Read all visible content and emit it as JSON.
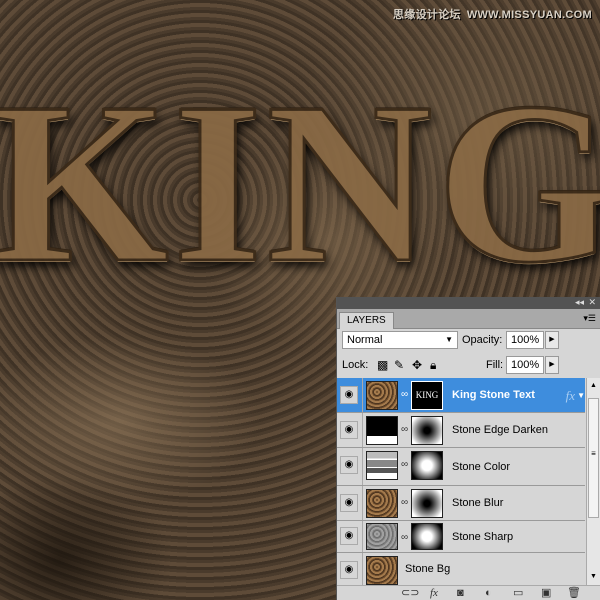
{
  "canvas": {
    "artwork_text": "KING"
  },
  "watermark": {
    "cn": "思缘设计论坛",
    "url": "WWW.MISSYUAN.COM"
  },
  "panel": {
    "collapse_icon": "double-chevron-left-icon",
    "close_icon": "close-icon",
    "tab": "LAYERS",
    "blend_mode": "Normal",
    "opacity_label": "Opacity:",
    "opacity": "100%",
    "lock_label": "Lock:",
    "fill_label": "Fill:",
    "fill": "100%",
    "layers": [
      {
        "name": "King Stone Text",
        "selected": true,
        "fx": "fx",
        "thumb": "stone",
        "mask": "KING"
      },
      {
        "name": "Stone Edge Darken",
        "thumb": "levels",
        "mask": "dark-center"
      },
      {
        "name": "Stone Color",
        "thumb": "hue-sat",
        "mask": "light-center"
      },
      {
        "name": "Stone Blur",
        "thumb": "stone",
        "mask": "dark-center"
      },
      {
        "name": "Stone Sharp",
        "thumb": "gray",
        "mask": "light-center"
      },
      {
        "name": "Stone Bg",
        "thumb": "stone"
      }
    ],
    "footer_icons": [
      "link-icon",
      "fx-icon",
      "mask-icon",
      "adjustment-icon",
      "folder-icon",
      "new-layer-icon",
      "trash-icon"
    ],
    "accent": "#3e8ddd"
  }
}
